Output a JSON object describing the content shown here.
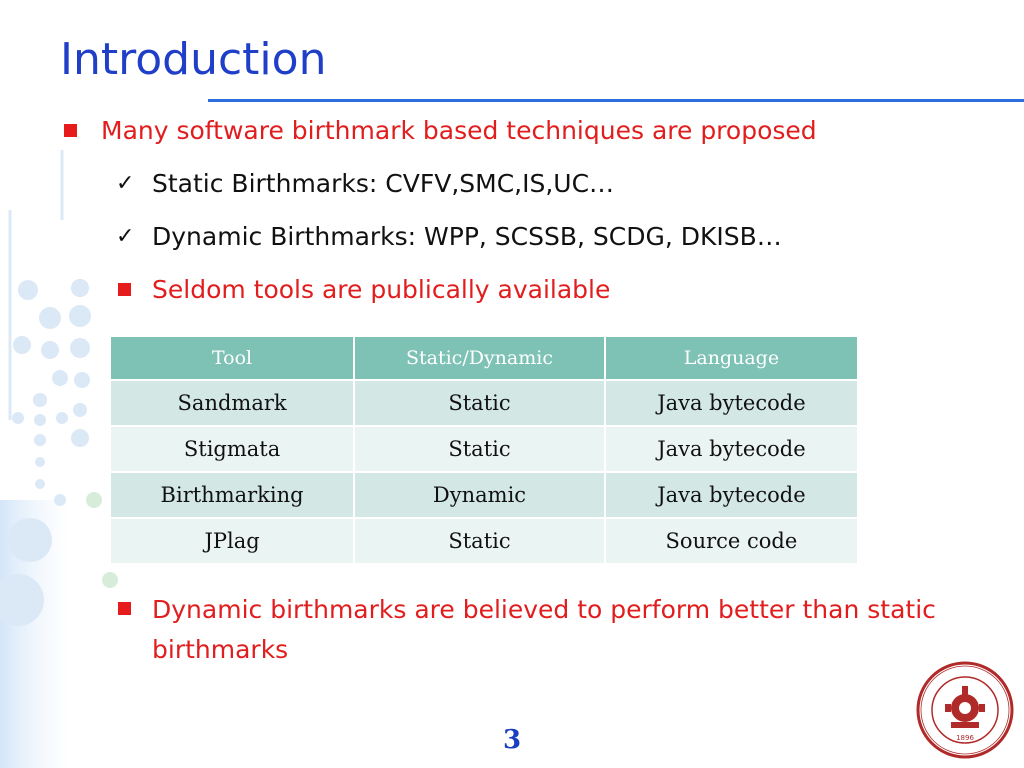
{
  "title": "Introduction",
  "bullets": {
    "main": "Many software birthmark based techniques are proposed",
    "static": "Static Birthmarks: CVFV,SMC,IS,UC…",
    "dynamic": "Dynamic Birthmarks: WPP, SCSSB, SCDG, DKISB…",
    "seldom": "Seldom tools are publically available",
    "better": "Dynamic birthmarks are believed to perform better than static birthmarks"
  },
  "check_glyph": "✓",
  "table": {
    "headers": [
      "Tool",
      "Static/Dynamic",
      "Language"
    ],
    "rows": [
      [
        "Sandmark",
        "Static",
        "Java bytecode"
      ],
      [
        "Stigmata",
        "Static",
        "Java bytecode"
      ],
      [
        "Birthmarking",
        "Dynamic",
        "Java bytecode"
      ],
      [
        "JPlag",
        "Static",
        "Source code"
      ]
    ]
  },
  "page_number": "3",
  "logo": {
    "text": "XI'AN JIAOTONG UNIVERSITY",
    "year": "1896"
  },
  "colors": {
    "title": "#1f3fc9",
    "accent_red": "#e11d1d",
    "table_header": "#7dc2b5"
  }
}
